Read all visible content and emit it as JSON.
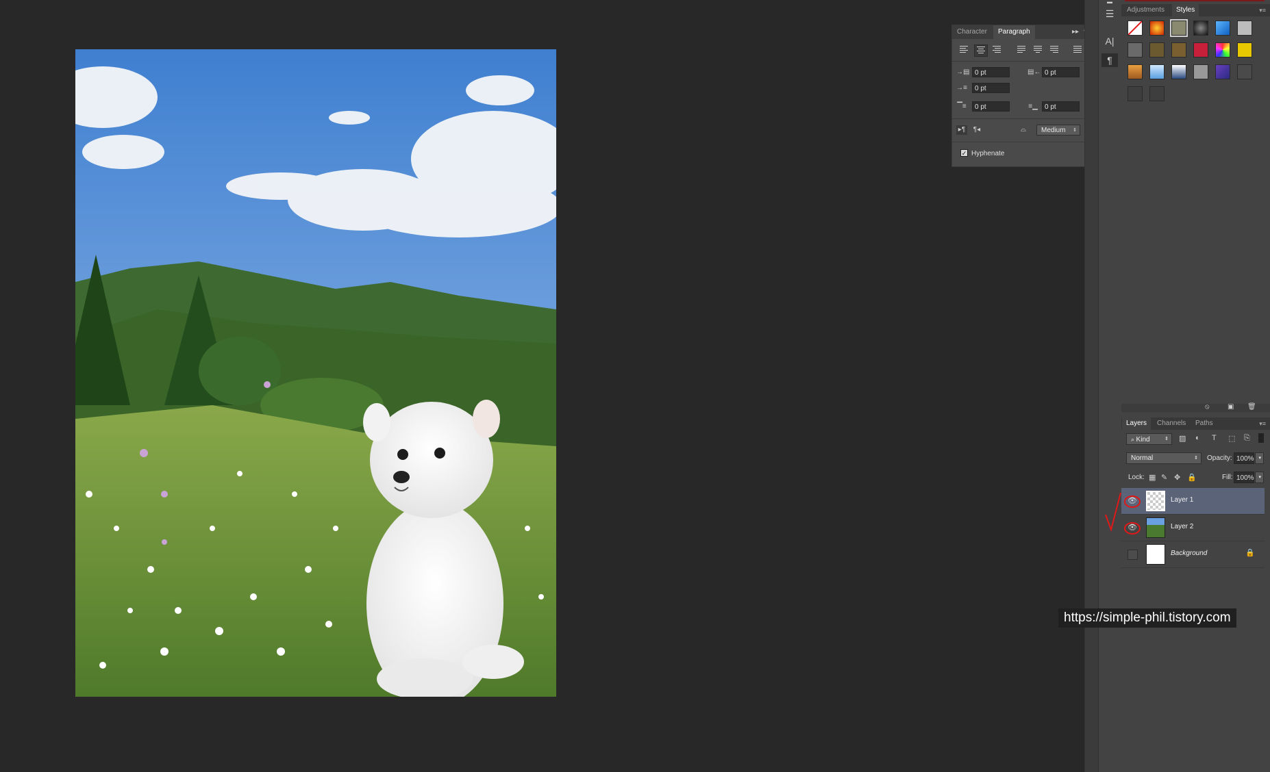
{
  "paragraph_panel": {
    "tabs": [
      "Character",
      "Paragraph"
    ],
    "active_tab": "Paragraph",
    "indent_left": "0 pt",
    "indent_right": "0 pt",
    "indent_first_line": "0 pt",
    "space_before": "0 pt",
    "space_after": "0 pt",
    "composer_value": "Medium",
    "hyphenate_label": "Hyphenate",
    "hyphenate_checked": true
  },
  "styles_panel": {
    "tabs": [
      "Adjustments",
      "Styles"
    ],
    "active_tab": "Styles"
  },
  "layers_panel": {
    "tabs": [
      "Layers",
      "Channels",
      "Paths"
    ],
    "active_tab": "Layers",
    "filter_kind": "Kind",
    "blend_mode": "Normal",
    "opacity_label": "Opacity:",
    "opacity_value": "100%",
    "lock_label": "Lock:",
    "fill_label": "Fill:",
    "fill_value": "100%",
    "layers": [
      {
        "name": "Layer 1",
        "visible": true,
        "selected": true
      },
      {
        "name": "Layer 2",
        "visible": true,
        "selected": false
      },
      {
        "name": "Background",
        "visible": false,
        "selected": false,
        "locked": true
      }
    ]
  },
  "canvas": {
    "content": "photo"
  },
  "watermark": "https://simple-phil.tistory.com",
  "colors": {
    "workspace_bg": "#282828",
    "panel_bg": "#434343",
    "selected_layer": "#5b6378",
    "annotation_red": "#e01818"
  }
}
